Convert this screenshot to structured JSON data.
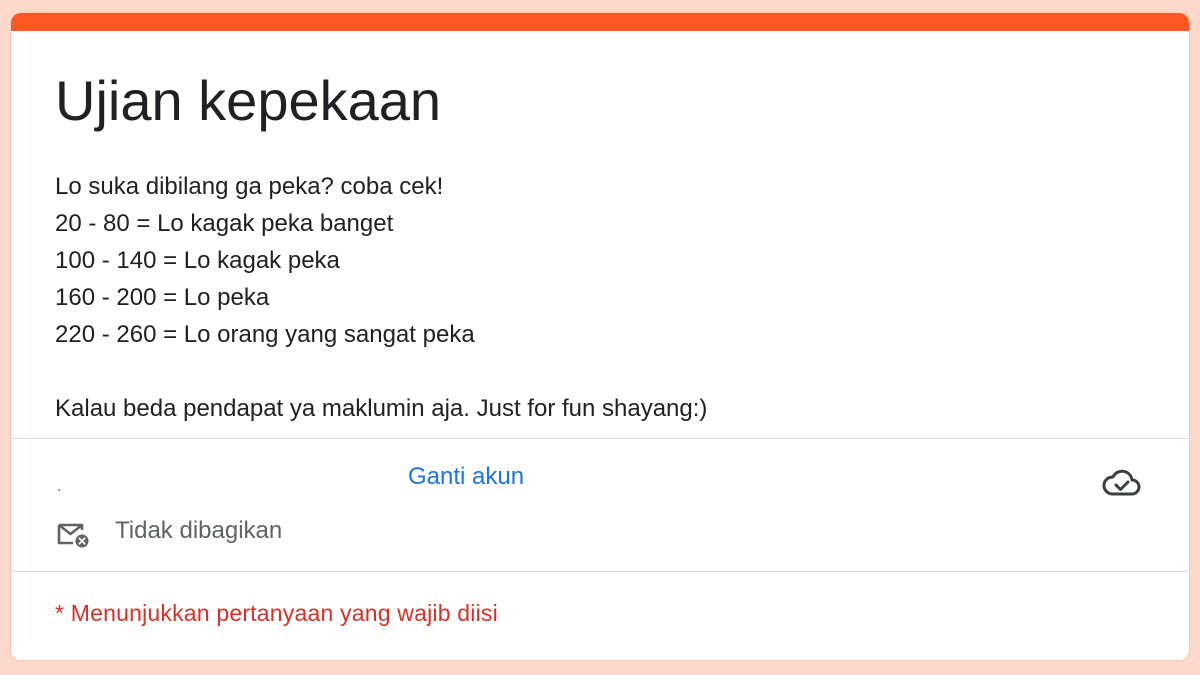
{
  "form": {
    "title": "Ujian kepekaan",
    "description_lines": [
      "Lo suka dibilang ga peka? coba cek!",
      "20 - 80 = Lo kagak peka banget",
      "100 - 140 = Lo kagak peka",
      "160 - 200 = Lo peka",
      "220 - 260 = Lo orang yang sangat peka",
      "",
      "Kalau beda pendapat ya maklumin aja. Just for fun shayang:)"
    ]
  },
  "account": {
    "email_placeholder": ".",
    "switch_label": "Ganti akun",
    "not_shared_label": "Tidak dibagikan"
  },
  "required_note": "* Menunjukkan pertanyaan yang wajib diisi",
  "icons": {
    "cloud": "cloud-done-icon",
    "mail": "mail-off-icon"
  },
  "colors": {
    "accent": "#ff5722",
    "page_background": "#fcd9cb",
    "link": "#1a73e8",
    "required": "#d93025"
  }
}
